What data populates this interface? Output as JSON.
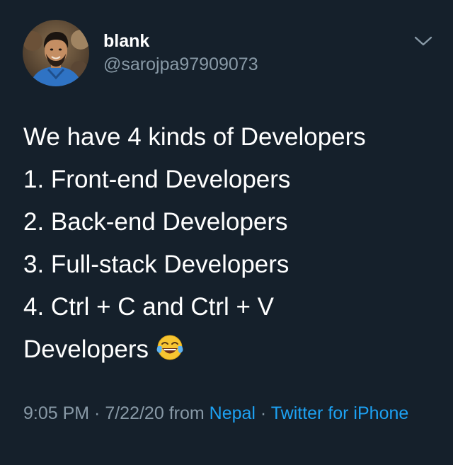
{
  "tweet": {
    "author": {
      "name": "blank",
      "handle": "@sarojpa97909073"
    },
    "lines": [
      "We have 4 kinds of Developers",
      "1. Front-end Developers",
      "2. Back-end Developers",
      "3. Full-stack Developers",
      "4. Ctrl + C and Ctrl + V",
      "Developers"
    ],
    "emoji": "face-with-tears-of-joy-emoji",
    "meta": {
      "time": "9:05 PM",
      "sep1": " · ",
      "date": "7/22/20",
      "from_label": " from ",
      "location": "Nepal",
      "sep2": " · ",
      "source": "Twitter for iPhone"
    },
    "colors": {
      "background": "#15202b",
      "text": "#ffffff",
      "secondary": "#8899a6",
      "link": "#1da1f2"
    }
  }
}
